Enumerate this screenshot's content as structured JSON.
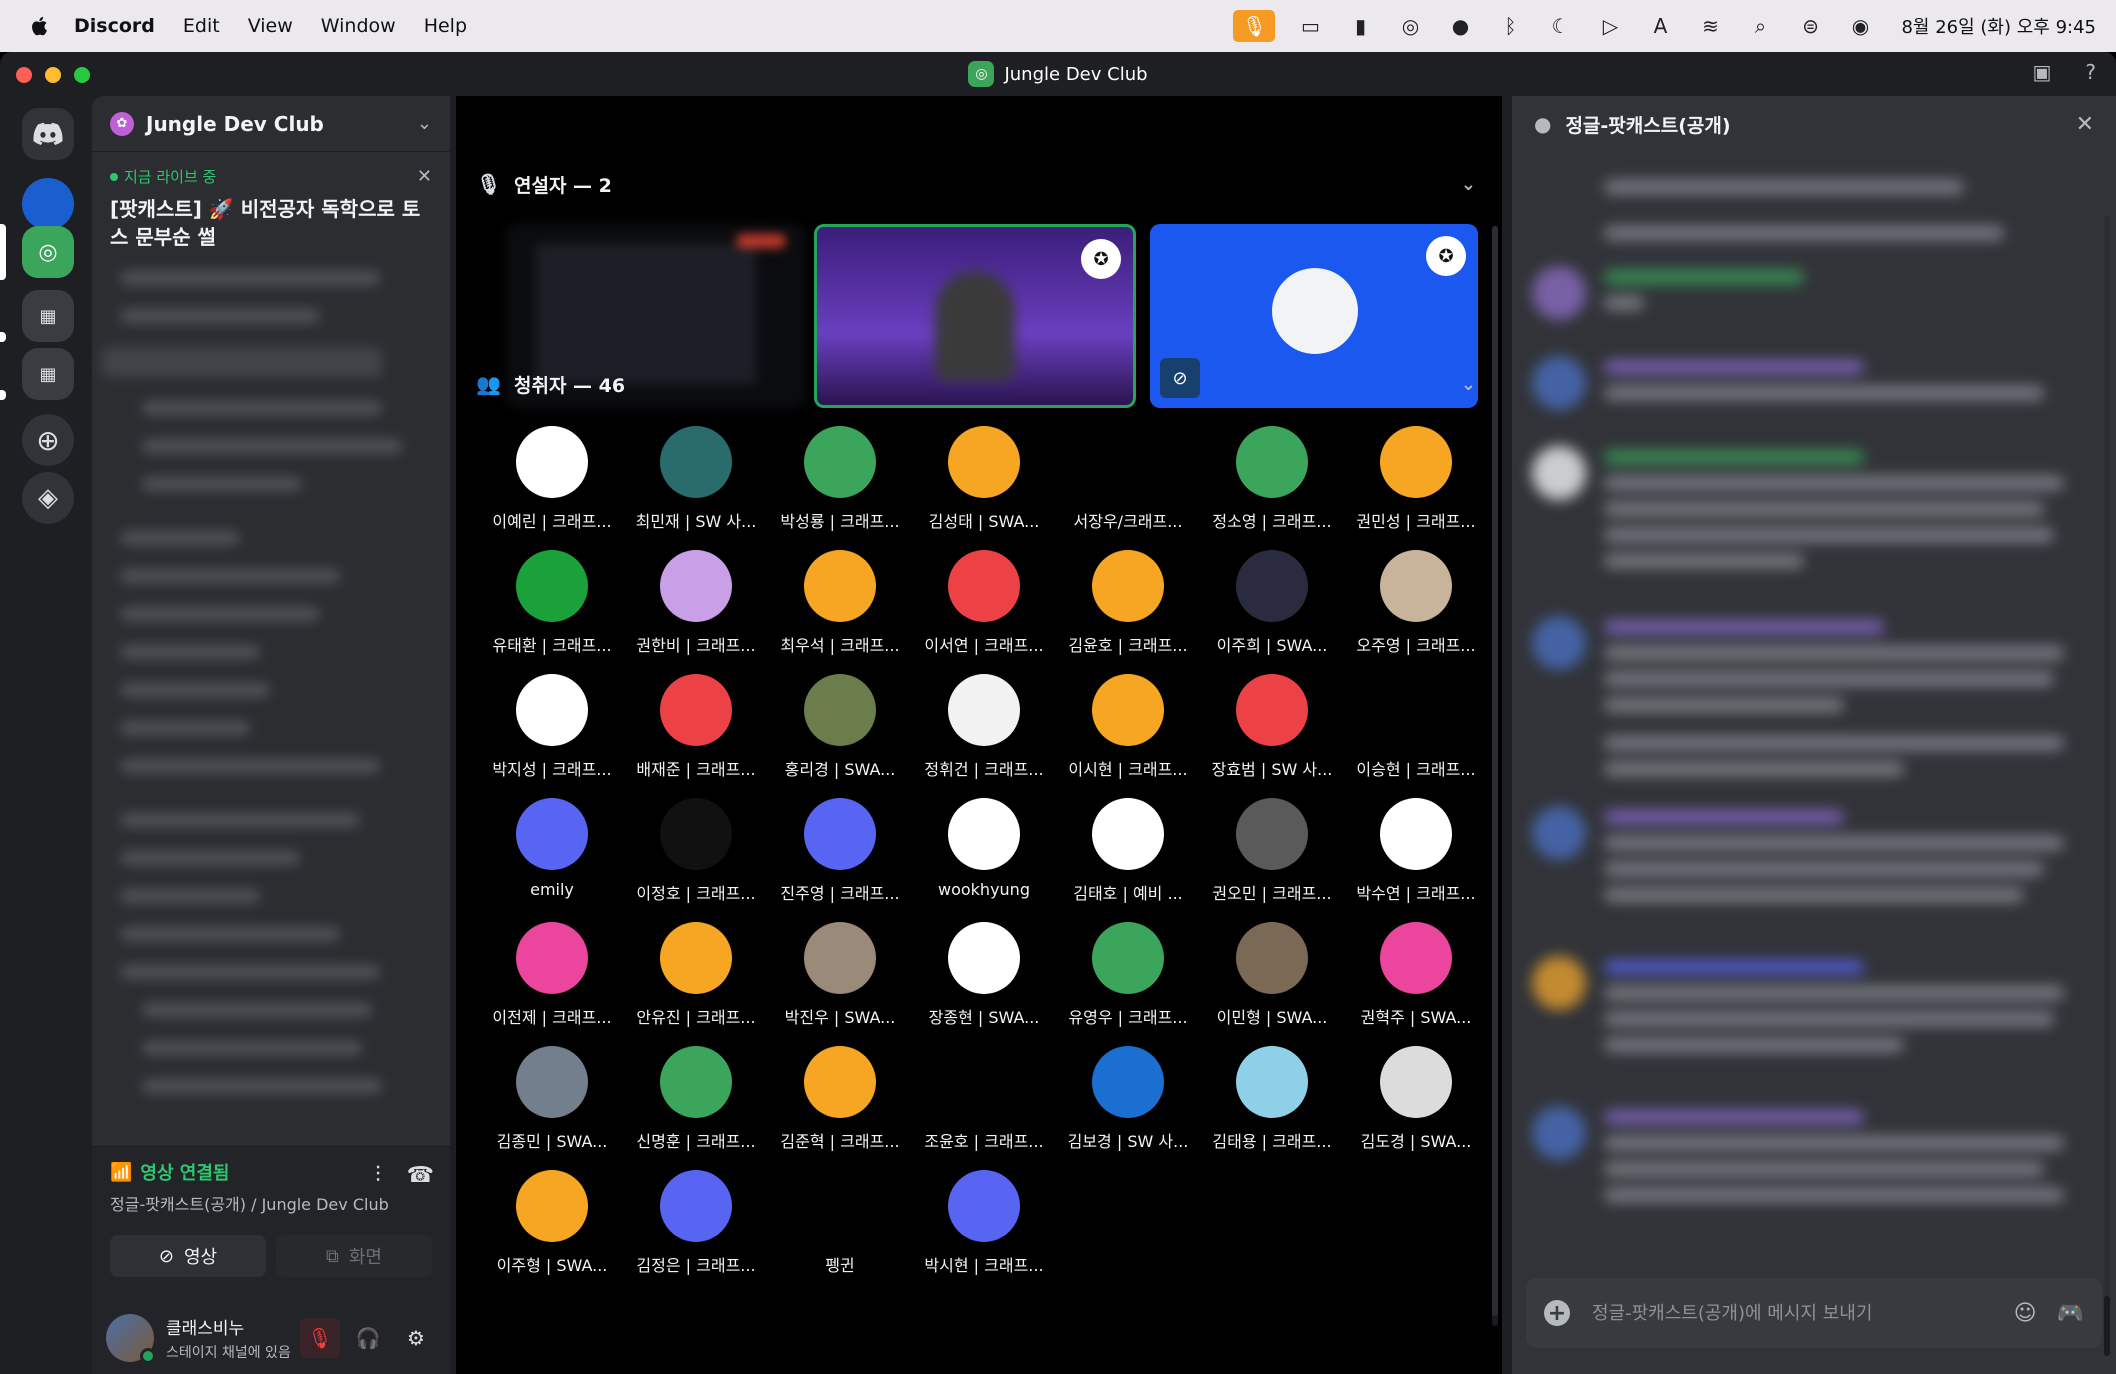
{
  "menubar": {
    "app": "Discord",
    "items": [
      "Edit",
      "View",
      "Window",
      "Help"
    ],
    "clock": "8월 26일 (화) 오후 9:45"
  },
  "window": {
    "title": "Jungle Dev Club"
  },
  "server": {
    "name": "Jungle Dev Club"
  },
  "live": {
    "tag": "지금 라이브 중",
    "title": "[팟캐스트] 🚀 비전공자 독학으로 토스 문부순 썰"
  },
  "voice": {
    "status": "영상 연결됨",
    "channel": "정글-팟캐스트(공개) / Jungle Dev Club",
    "video_label": "영상",
    "screen_label": "화면"
  },
  "user": {
    "name": "클래스비누",
    "status": "스테이지 채널에 있음"
  },
  "stage": {
    "speakers_label": "연설자 — 2",
    "audience_label": "청취자 — 46",
    "audience": [
      {
        "name": "이예린 | 크래프...",
        "color": "#ffffff"
      },
      {
        "name": "최민재 | SW 사...",
        "color": "#2a6b6b"
      },
      {
        "name": "박성룡 | 크래프...",
        "color": "#3ba55c"
      },
      {
        "name": "김성태 | SWA...",
        "color": "#f6a623"
      },
      {
        "name": "서장우/크래프...",
        "color": "#000000"
      },
      {
        "name": "정소영 | 크래프...",
        "color": "#3ba55c"
      },
      {
        "name": "권민성 | 크래프...",
        "color": "#f6a623"
      },
      {
        "name": "유태환 | 크래프...",
        "color": "#1aa13a"
      },
      {
        "name": "권한비 | 크래프...",
        "color": "#c9a0e8"
      },
      {
        "name": "최우석 | 크래프...",
        "color": "#f6a623"
      },
      {
        "name": "이서연 | 크래프...",
        "color": "#ed4245"
      },
      {
        "name": "김윤호 | 크래프...",
        "color": "#f6a623"
      },
      {
        "name": "이주희 | SWA...",
        "color": "#2b2b40"
      },
      {
        "name": "오주영 | 크래프...",
        "color": "#c8b49a"
      },
      {
        "name": "박지성 | 크래프...",
        "color": "#ffffff"
      },
      {
        "name": "배재준 | 크래프...",
        "color": "#ed4245"
      },
      {
        "name": "홍리경 | SWA...",
        "color": "#6a7d4a"
      },
      {
        "name": "정휘건 | 크래프...",
        "color": "#f2f2f2"
      },
      {
        "name": "이시현 | 크래프...",
        "color": "#f6a623"
      },
      {
        "name": "장효범 | SW 사...",
        "color": "#ed4245"
      },
      {
        "name": "이승현 | 크래프...",
        "color": "#000000"
      },
      {
        "name": "emily",
        "color": "#5865f2"
      },
      {
        "name": "이정호 | 크래프...",
        "color": "#111111"
      },
      {
        "name": "진주영 | 크래프...",
        "color": "#5865f2"
      },
      {
        "name": "wookhyung",
        "color": "#ffffff"
      },
      {
        "name": "김태호 | 예비 ...",
        "color": "#ffffff"
      },
      {
        "name": "권오민 | 크래프...",
        "color": "#5a5a5a"
      },
      {
        "name": "박수연 | 크래프...",
        "color": "#ffffff"
      },
      {
        "name": "이전제 | 크래프...",
        "color": "#eb459e"
      },
      {
        "name": "안유진 | 크래프...",
        "color": "#f6a623"
      },
      {
        "name": "박진우 | SWA...",
        "color": "#9a8a7a"
      },
      {
        "name": "장종현 | SWA...",
        "color": "#ffffff"
      },
      {
        "name": "유영우 | 크래프...",
        "color": "#3ba55c"
      },
      {
        "name": "이민형 | SWA...",
        "color": "#7a6a55"
      },
      {
        "name": "권혁주 | SWA...",
        "color": "#eb459e"
      },
      {
        "name": "김종민 | SWA...",
        "color": "#747f8d"
      },
      {
        "name": "신명훈 | 크래프...",
        "color": "#3ba55c"
      },
      {
        "name": "김준혁 | 크래프...",
        "color": "#f6a623"
      },
      {
        "name": "조윤호 | 크래프...",
        "color": "#000000"
      },
      {
        "name": "김보경 | SW 사...",
        "color": "#1a6fd0"
      },
      {
        "name": "김태용 | 크래프...",
        "color": "#8ed0e8"
      },
      {
        "name": "김도경 | SWA...",
        "color": "#dcdcdc"
      },
      {
        "name": "이주형 | SWA...",
        "color": "#f6a623"
      },
      {
        "name": "김정은 | 크래프...",
        "color": "#5865f2"
      },
      {
        "name": "펭귄",
        "color": "#000000"
      },
      {
        "name": "박시현 | 크래프...",
        "color": "#5865f2"
      }
    ]
  },
  "chat": {
    "channel": "정글-팟캐스트(공개)",
    "placeholder": "정글-팟캐스트(공개)에 메시지 보내기"
  },
  "colors": {
    "accent_green": "#23a55a",
    "blurple": "#5865f2",
    "menubar_mic": "#f59a23"
  }
}
